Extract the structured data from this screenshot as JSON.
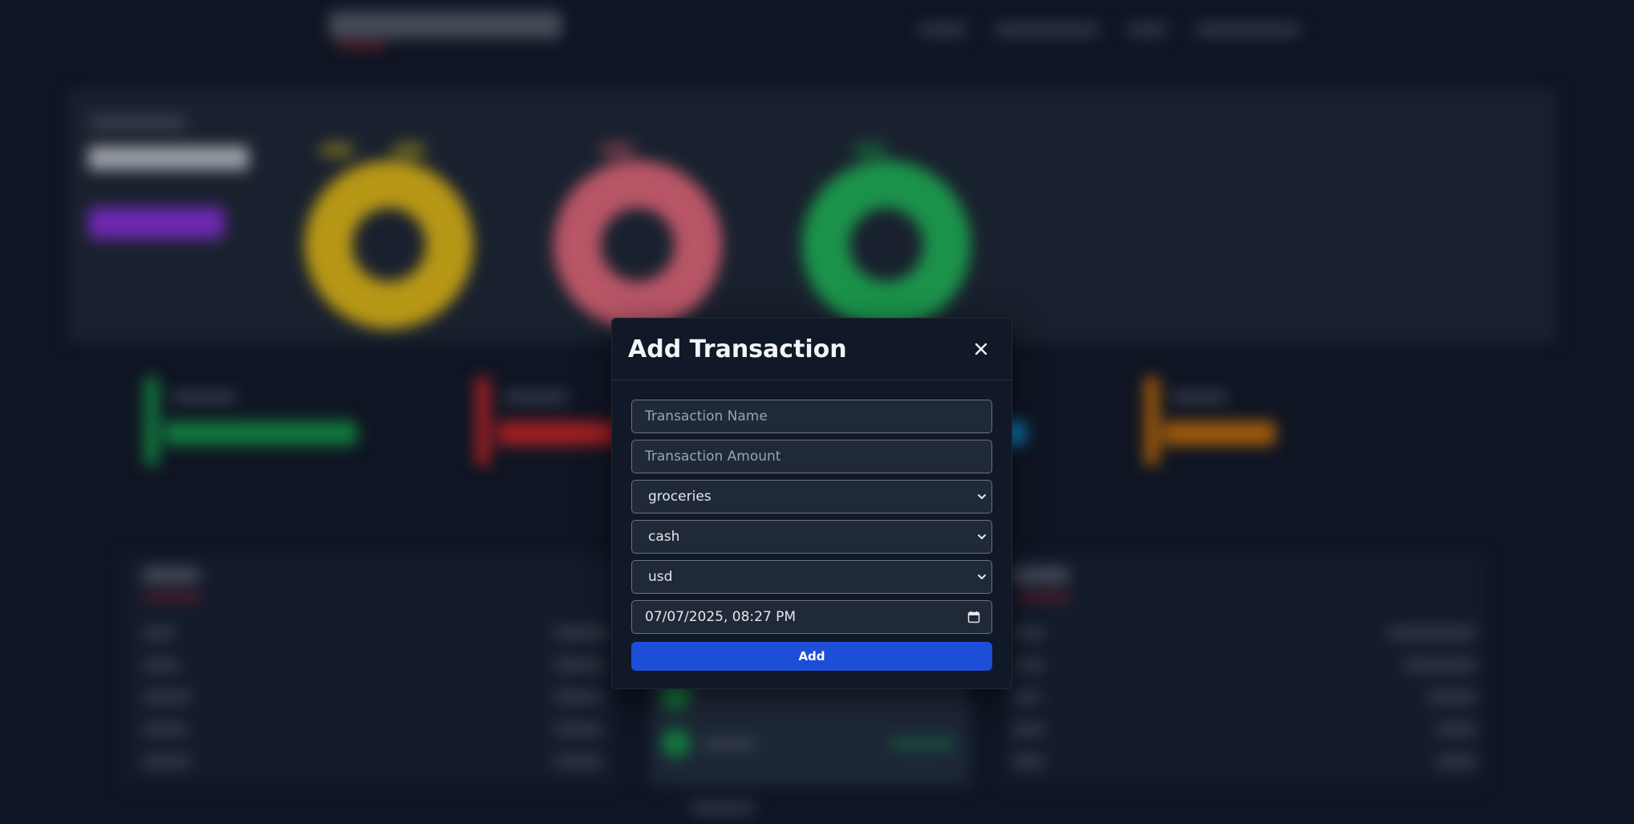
{
  "modal": {
    "title": "Add Transaction",
    "close_icon": "close-icon",
    "name_placeholder": "Transaction Name",
    "amount_placeholder": "Transaction Amount",
    "category_selected": "groceries",
    "payment_selected": "cash",
    "currency_selected": "usd",
    "datetime_value": "07/07/2025, 08:27 PM",
    "calendar_icon": "calendar-icon",
    "add_label": "Add"
  },
  "colors": {
    "primary_button": "#1d4ed8",
    "modal_bg": "#111827",
    "field_bg": "#1f2937",
    "donut_yellow": "#facc15",
    "donut_pink": "#fb7185",
    "donut_green": "#22c55e",
    "accent_purple": "#9333ea"
  }
}
